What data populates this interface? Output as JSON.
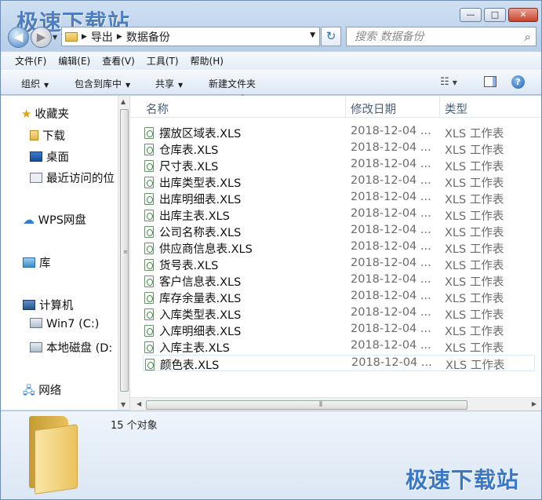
{
  "window": {
    "watermark_top": "极速下载站",
    "controls": {
      "minimize": "—",
      "maximize": "□",
      "close": "✕"
    }
  },
  "nav": {
    "back_icon": "◀",
    "forward_icon": "▶",
    "breadcrumb": [
      "导出",
      "数据备份"
    ],
    "search_placeholder": "搜索 数据备份",
    "refresh_icon": "↻",
    "search_icon": "⌕"
  },
  "menu": [
    "文件(F)",
    "编辑(E)",
    "查看(V)",
    "工具(T)",
    "帮助(H)"
  ],
  "toolbar": {
    "organize": "组织",
    "include_library": "包含到库中",
    "share": "共享",
    "new_folder": "新建文件夹"
  },
  "sidebar": {
    "favorites": "收藏夹",
    "downloads": "下载",
    "desktop": "桌面",
    "recent": "最近访问的位",
    "wps": "WPS网盘",
    "library": "库",
    "computer": "计算机",
    "drive_c": "Win7 (C:)",
    "drive_d": "本地磁盘 (D:",
    "network": "网络"
  },
  "columns": {
    "name": "名称",
    "date": "修改日期",
    "type": "类型"
  },
  "files": [
    {
      "name": "摆放区域表.XLS",
      "date": "2018-12-04 ...",
      "type": "XLS 工作表"
    },
    {
      "name": "仓库表.XLS",
      "date": "2018-12-04 ...",
      "type": "XLS 工作表"
    },
    {
      "name": "尺寸表.XLS",
      "date": "2018-12-04 ...",
      "type": "XLS 工作表"
    },
    {
      "name": "出库类型表.XLS",
      "date": "2018-12-04 ...",
      "type": "XLS 工作表"
    },
    {
      "name": "出库明细表.XLS",
      "date": "2018-12-04 ...",
      "type": "XLS 工作表"
    },
    {
      "name": "出库主表.XLS",
      "date": "2018-12-04 ...",
      "type": "XLS 工作表"
    },
    {
      "name": "公司名称表.XLS",
      "date": "2018-12-04 ...",
      "type": "XLS 工作表"
    },
    {
      "name": "供应商信息表.XLS",
      "date": "2018-12-04 ...",
      "type": "XLS 工作表"
    },
    {
      "name": "货号表.XLS",
      "date": "2018-12-04 ...",
      "type": "XLS 工作表"
    },
    {
      "name": "客户信息表.XLS",
      "date": "2018-12-04 ...",
      "type": "XLS 工作表"
    },
    {
      "name": "库存余量表.XLS",
      "date": "2018-12-04 ...",
      "type": "XLS 工作表"
    },
    {
      "name": "入库类型表.XLS",
      "date": "2018-12-04 ...",
      "type": "XLS 工作表"
    },
    {
      "name": "入库明细表.XLS",
      "date": "2018-12-04 ...",
      "type": "XLS 工作表"
    },
    {
      "name": "入库主表.XLS",
      "date": "2018-12-04 ...",
      "type": "XLS 工作表"
    },
    {
      "name": "颜色表.XLS",
      "date": "2018-12-04 ...",
      "type": "XLS 工作表"
    }
  ],
  "status": {
    "count": "15 个对象",
    "watermark_bottom": "极速下载站"
  }
}
